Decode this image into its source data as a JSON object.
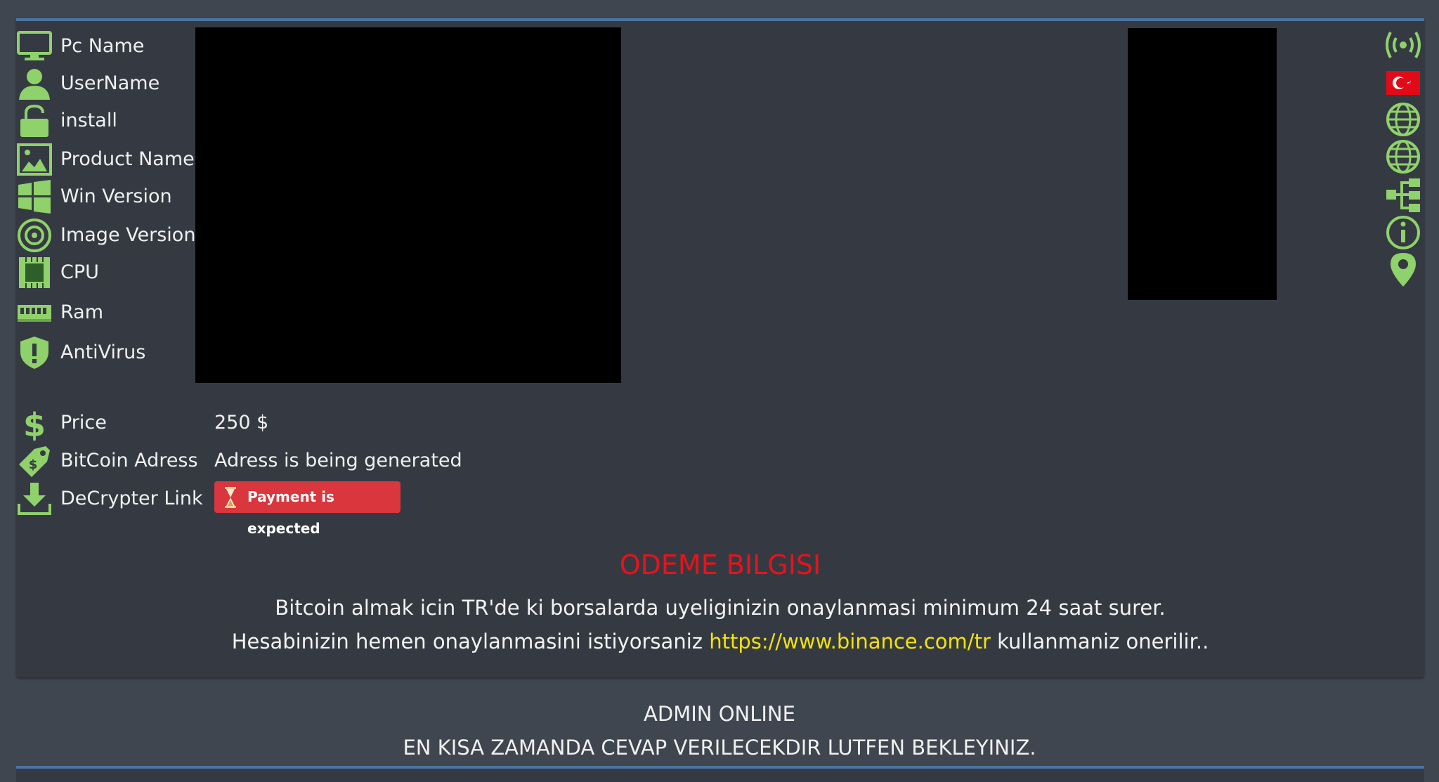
{
  "info_rows": [
    {
      "label": "Pc Name",
      "icon": "monitor-icon"
    },
    {
      "label": "UserName",
      "icon": "user-icon"
    },
    {
      "label": "install",
      "icon": "lock-icon"
    },
    {
      "label": "Product Name",
      "icon": "image-icon"
    },
    {
      "label": "Win Version",
      "icon": "windows-icon"
    },
    {
      "label": "Image Version",
      "icon": "disc-icon"
    },
    {
      "label": "CPU",
      "icon": "cpu-icon"
    },
    {
      "label": "Ram",
      "icon": "ram-icon"
    },
    {
      "label": "AntiVirus",
      "icon": "shield-icon"
    }
  ],
  "payment": {
    "price_label": "Price",
    "price_value": "250 $",
    "bitcoin_label": "BitCoin Adress",
    "bitcoin_value": "Adress is being generated",
    "decrypter_label": "DeCrypter Link",
    "decrypter_status": "Payment is expected"
  },
  "right_icons": [
    "broadcast-icon",
    "turkey-flag-icon",
    "globe-icon",
    "globe-icon",
    "network-tree-icon",
    "info-icon",
    "location-pin-icon"
  ],
  "notice": {
    "title": "ODEME BILGISI",
    "line1": "Bitcoin almak icin TR'de ki borsalarda uyeliginizin onaylanmasi minimum 24 saat surer.",
    "line2_before": "Hesabinizin hemen onaylanmasini istiyorsaniz ",
    "line2_link": "https://www.binance.com/tr",
    "line2_after": " kullanmaniz onerilir.."
  },
  "footer": {
    "admin_status": "ADMIN ONLINE",
    "wait_message": "EN KISA ZAMANDA CEVAP VERILECEKDIR LUTFEN BEKLEYINIZ."
  },
  "colors": {
    "accent_green": "#8fd16a",
    "title_red": "#e8121b",
    "link_yellow": "#f4e20a",
    "badge_red": "#d9363e",
    "panel_border": "#4a74a4"
  }
}
